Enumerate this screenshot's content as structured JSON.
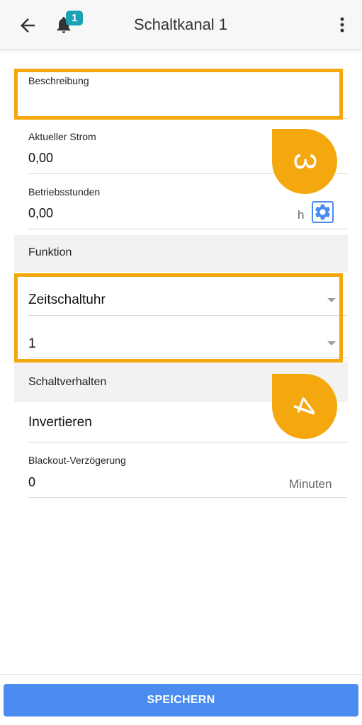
{
  "header": {
    "title": "Schaltkanal 1",
    "notification_count": "1",
    "back_icon": "arrow-left-icon",
    "bell_icon": "bell-icon",
    "more_icon": "more-vert-icon"
  },
  "fields": {
    "beschreibung": {
      "label": "Beschreibung",
      "value": ""
    },
    "aktueller_strom": {
      "label": "Aktueller Strom",
      "value": "0,00"
    },
    "betriebsstunden": {
      "label": "Betriebsstunden",
      "value": "0,00",
      "unit": "h",
      "settings_icon": "gear-icon"
    },
    "funktion": {
      "section_label": "Funktion",
      "mode_value": "Zeitschaltuhr",
      "channel_value": "1"
    },
    "schaltverhalten": {
      "section_label": "Schaltverhalten",
      "toggle_label": "Invertieren"
    },
    "blackout": {
      "label": "Blackout-Verzögerung",
      "value": "0",
      "unit": "Minuten"
    }
  },
  "annotations": {
    "first": "3",
    "second": "4"
  },
  "footer": {
    "save_label": "SPEICHERN"
  },
  "colors": {
    "accent": "#4a8cf0",
    "highlight": "#f5a80e",
    "badge": "#1aa3b5"
  }
}
